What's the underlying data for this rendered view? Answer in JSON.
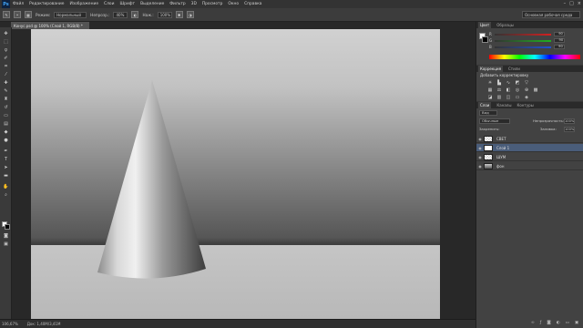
{
  "menu": {
    "logo": "Ps",
    "items": [
      "Файл",
      "Редактирование",
      "Изображение",
      "Слои",
      "Шрифт",
      "Выделение",
      "Фильтр",
      "3D",
      "Просмотр",
      "Окно",
      "Справка"
    ],
    "window_controls": [
      "–",
      "□",
      "×"
    ]
  },
  "options": {
    "mode_label": "Режим:",
    "mode_value": "Нормальный",
    "opacity_label": "Непрозр.:",
    "opacity_value": "40%",
    "flow_label": "Наж.:",
    "flow_value": "100%",
    "workspace": "Основная рабочая среда"
  },
  "document": {
    "tab_title": "Конус.psd @ 100% (Слой 1, RGB/8) *"
  },
  "status": {
    "zoom": "106,67%",
    "doc_size": "Док: 1,40М/3,41М"
  },
  "color_panel": {
    "tabs": [
      "Цвет",
      "Образцы"
    ],
    "sliders": [
      {
        "label": "R",
        "value": "90",
        "color": "#d32020"
      },
      {
        "label": "G",
        "value": "90",
        "color": "#20b020"
      },
      {
        "label": "B",
        "value": "90",
        "color": "#2050d0"
      }
    ]
  },
  "adjustments_panel": {
    "tabs": [
      "Коррекция",
      "Стили"
    ],
    "title": "Добавить корректировку"
  },
  "layers_panel": {
    "tabs": [
      "Слои",
      "Каналы",
      "Контуры"
    ],
    "filter_label": "Вид",
    "blend_mode": "Обычные",
    "opacity_label": "Непрозрачность:",
    "opacity_value": "100%",
    "lock_label": "Закрепить:",
    "fill_label": "Заливка:",
    "fill_value": "100%",
    "layers": [
      {
        "name": "СВЕТ",
        "thumb": "checker",
        "selected": false
      },
      {
        "name": "Слой 1",
        "thumb": "cone",
        "selected": true
      },
      {
        "name": "ШУМ",
        "thumb": "checker",
        "selected": false
      },
      {
        "name": "фон",
        "thumb": "grad",
        "selected": false
      }
    ]
  }
}
